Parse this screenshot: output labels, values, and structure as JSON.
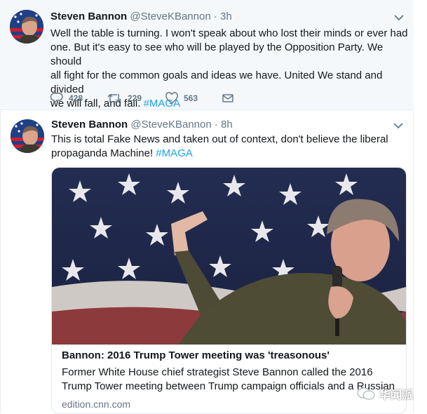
{
  "colors": {
    "link": "#1da1f2",
    "secondary": "#657786",
    "background_highlight": "#f5f8fa"
  },
  "tweets": [
    {
      "name": "Steven Bannon",
      "handle": "@SteveKBannon",
      "separator": "·",
      "time": "3h",
      "text_lines": [
        "Well the table is turning. I won't speak about who lost their minds or ever had",
        "one. But it's easy to see who will be played by the Opposition Party. We should",
        "all fight for the common goals and ideas we have. United We stand and divided",
        "we will fall, and fail."
      ],
      "hashtag": "#MAGA",
      "replies": "428",
      "retweets": "229",
      "likes": "563"
    },
    {
      "name": "Steven Bannon",
      "handle": "@SteveKBannon",
      "separator": "·",
      "time": "8h",
      "text_lines": [
        "This is total Fake News and taken out of context, don't believe the liberal",
        "propaganda Machine!"
      ],
      "hashtag": "#MAGA",
      "card": {
        "title": "Bannon: 2016 Trump Tower meeting was 'treasonous'",
        "description": "Former White House chief strategist Steve Bannon called the 2016 Trump Tower meeting between Trump campaign officials and a Russian lawyer p...",
        "domain": "edition.cnn.com"
      }
    }
  ],
  "watermark": {
    "text": "华闻派"
  },
  "icons": [
    "reply-icon",
    "retweet-icon",
    "like-icon",
    "direct-message-icon",
    "chevron-down-icon"
  ]
}
